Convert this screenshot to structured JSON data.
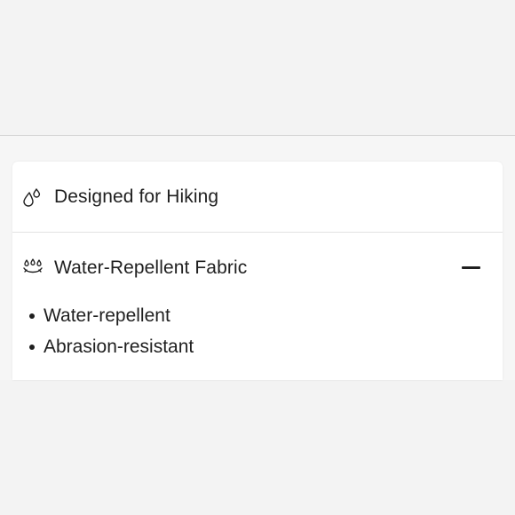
{
  "accordion": {
    "items": [
      {
        "label": "Designed for Hiking",
        "icon": "water-drops-icon",
        "expanded": false
      },
      {
        "label": "Water-Repellent Fabric",
        "icon": "water-repellent-icon",
        "expanded": true,
        "toggle_icon": "minus-icon",
        "bullets": [
          "Water-repellent",
          "Abrasion-resistant"
        ]
      }
    ]
  },
  "colors": {
    "page_background": "#f4f4f4",
    "card_background": "#ffffff",
    "text": "#1f1f1f",
    "divider": "#e2e2e2"
  }
}
